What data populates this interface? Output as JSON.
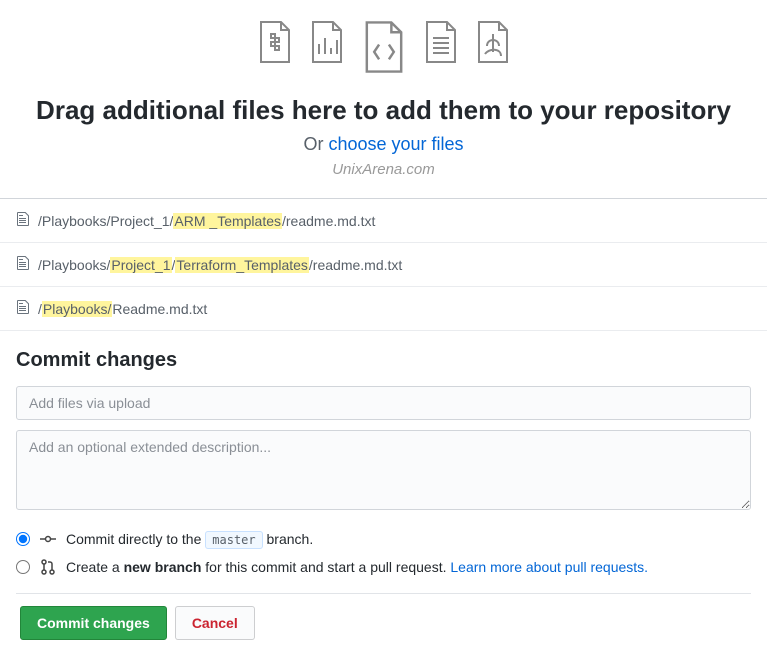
{
  "upload": {
    "heading": "Drag additional files here to add them to your repository",
    "or": "Or ",
    "choose": "choose your files",
    "watermark": "UnixArena.com"
  },
  "files": [
    {
      "segments": [
        {
          "text": "/Playbooks/Project_1/",
          "hl": false
        },
        {
          "text": "ARM _Templates",
          "hl": true
        },
        {
          "text": "/readme.md.txt",
          "hl": false
        }
      ]
    },
    {
      "segments": [
        {
          "text": "/Playbooks/",
          "hl": false
        },
        {
          "text": "Project_1",
          "hl": true
        },
        {
          "text": "/",
          "hl": false
        },
        {
          "text": "Terraform_Templates",
          "hl": true
        },
        {
          "text": "/readme.md.txt",
          "hl": false
        }
      ]
    },
    {
      "segments": [
        {
          "text": "/",
          "hl": false
        },
        {
          "text": "Playbooks/",
          "hl": true
        },
        {
          "text": "Readme.md.txt",
          "hl": false
        }
      ]
    }
  ],
  "commit": {
    "heading": "Commit changes",
    "summary_placeholder": "Add files via upload",
    "desc_placeholder": "Add an optional extended description...",
    "direct_pre": "Commit directly to the ",
    "branch": "master",
    "direct_post": " branch.",
    "newbranch_pre": "Create a ",
    "newbranch_bold": "new branch",
    "newbranch_post": " for this commit and start a pull request. ",
    "learn": "Learn more about pull requests."
  },
  "actions": {
    "commit": "Commit changes",
    "cancel": "Cancel"
  }
}
